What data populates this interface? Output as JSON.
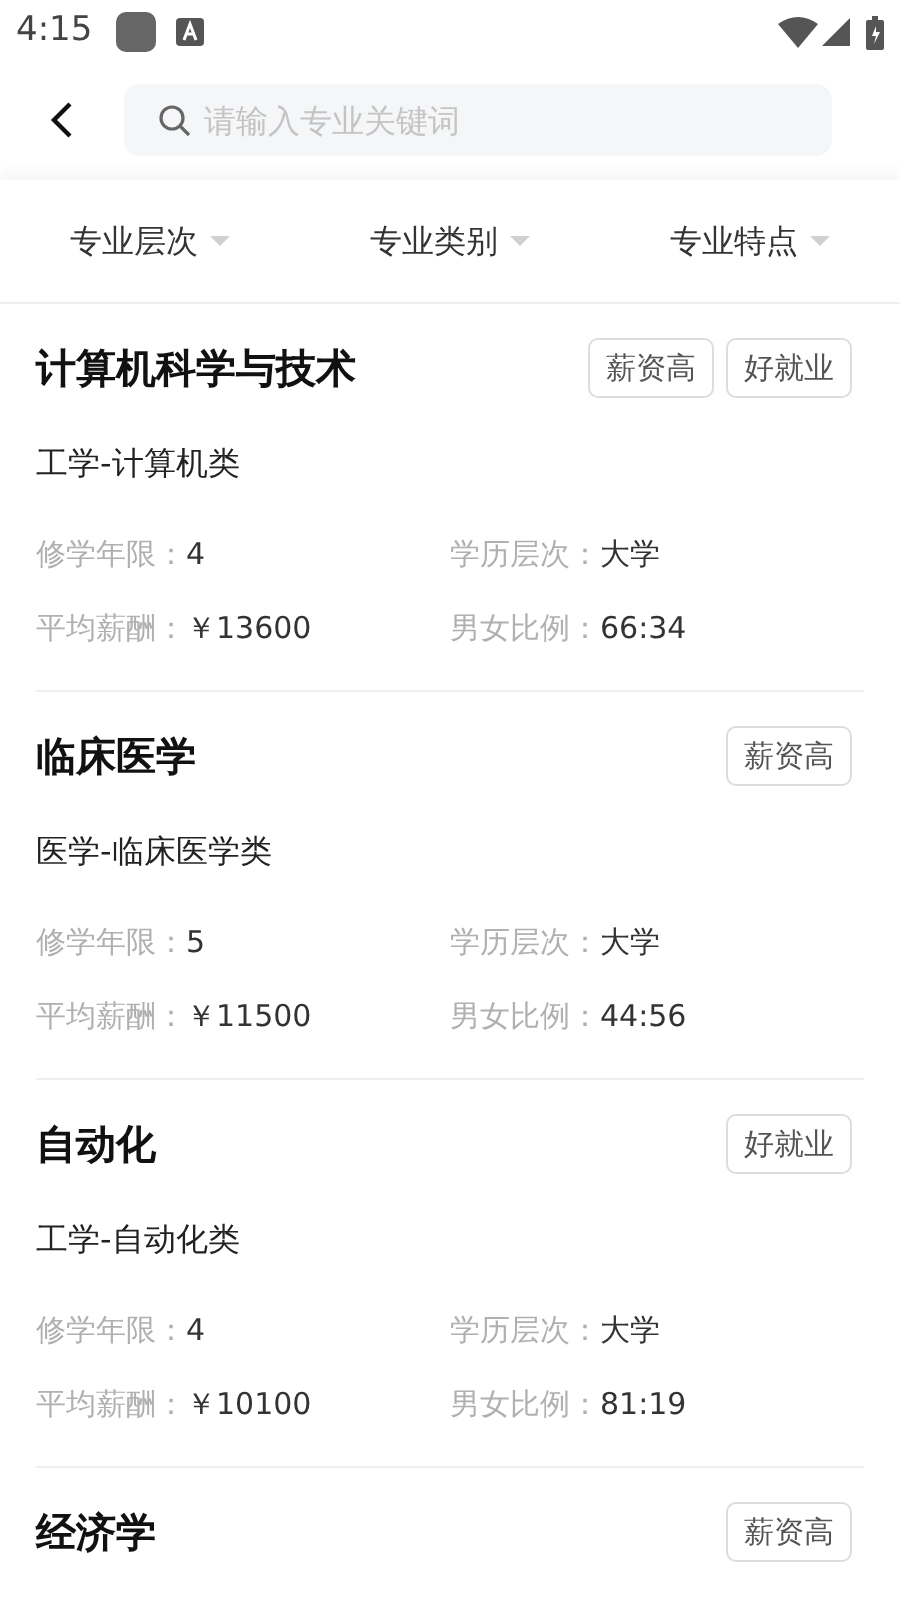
{
  "status_bar": {
    "time": "4:15"
  },
  "search": {
    "placeholder": "请输入专业关键词"
  },
  "filters": [
    {
      "label": "专业层次"
    },
    {
      "label": "专业类别"
    },
    {
      "label": "专业特点"
    }
  ],
  "majors": [
    {
      "name": "计算机科学与技术",
      "tags": [
        "薪资高",
        "好就业"
      ],
      "category": "工学-计算机类",
      "years_label": "修学年限：",
      "years": "4",
      "level_label": "学历层次：",
      "level_value": "大学",
      "salary_label": "平均薪酬：",
      "salary": "￥13600",
      "ratio_label": "男女比例：",
      "ratio": "66:34"
    },
    {
      "name": "临床医学",
      "tags": [
        "薪资高"
      ],
      "category": "医学-临床医学类",
      "years_label": "修学年限：",
      "years": "5",
      "level_label": "学历层次：",
      "level_value": "大学",
      "salary_label": "平均薪酬：",
      "salary": "￥11500",
      "ratio_label": "男女比例：",
      "ratio": "44:56"
    },
    {
      "name": "自动化",
      "tags": [
        "好就业"
      ],
      "category": "工学-自动化类",
      "years_label": "修学年限：",
      "years": "4",
      "level_label": "学历层次：",
      "level_value": "大学",
      "salary_label": "平均薪酬：",
      "salary": "￥10100",
      "ratio_label": "男女比例：",
      "ratio": "81:19"
    },
    {
      "name": "经济学",
      "tags": [
        "薪资高"
      ]
    }
  ]
}
